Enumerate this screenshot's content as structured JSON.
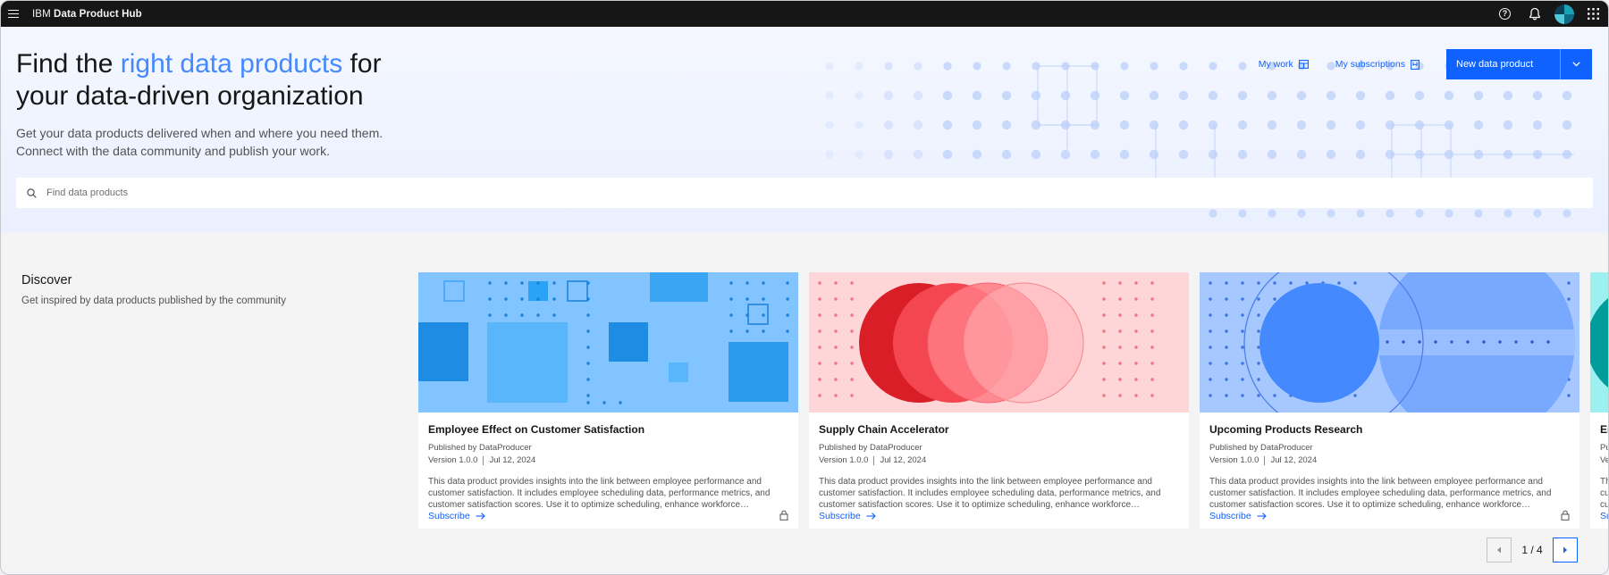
{
  "topbar": {
    "brand_prefix": "IBM",
    "brand_name": "Data Product Hub",
    "icons": [
      "menu-icon",
      "help-icon",
      "notification-icon",
      "avatar",
      "app-switcher-icon"
    ]
  },
  "hero": {
    "title_part1": "Find the ",
    "title_accent": "right data products",
    "title_part2": " for your data-driven organization",
    "subtitle_line1": "Get your data products delivered when and where you need them.",
    "subtitle_line2": "Connect with the data community and publish your work.",
    "my_work_label": "My work",
    "my_subscriptions_label": "My subscriptions",
    "new_product_label": "New data product",
    "search_placeholder": "Find data products"
  },
  "discover": {
    "title": "Discover",
    "subtitle": "Get inspired by data products published by the community"
  },
  "cards": [
    {
      "title": "Employee Effect on Customer Satisfaction",
      "publisher": "Published by DataProducer",
      "version": "Version 1.0.0",
      "date": "Jul 12, 2024",
      "description": "This data product provides insights into the link between employee performance and customer satisfaction. It includes employee scheduling data, performance metrics, and customer satisfaction scores. Use it to optimize scheduling, enhance workforce…",
      "action": "Subscribe",
      "locked": true
    },
    {
      "title": "Supply Chain Accelerator",
      "publisher": "Published by DataProducer",
      "version": "Version 1.0.0",
      "date": "Jul 12, 2024",
      "description": "This data product provides insights into the link between employee performance and customer satisfaction. It includes employee scheduling data, performance metrics, and customer satisfaction scores. Use it to optimize scheduling, enhance workforce…",
      "action": "Subscribe",
      "locked": false
    },
    {
      "title": "Upcoming Products Research",
      "publisher": "Published by DataProducer",
      "version": "Version 1.0.0",
      "date": "Jul 12, 2024",
      "description": "This data product provides insights into the link between employee performance and customer satisfaction. It includes employee scheduling data, performance metrics, and customer satisfaction scores. Use it to optimize scheduling, enhance workforce…",
      "action": "Subscribe",
      "locked": true
    },
    {
      "title": "Er",
      "publisher": "Pu",
      "version": "Ve",
      "date": "",
      "description": "Th cu cu",
      "action": "Su",
      "locked": false
    }
  ],
  "pager": {
    "label": "1 / 4"
  },
  "colors": {
    "accent": "#0f62fe",
    "accent_light": "#4589ff",
    "topbar": "#161616"
  }
}
